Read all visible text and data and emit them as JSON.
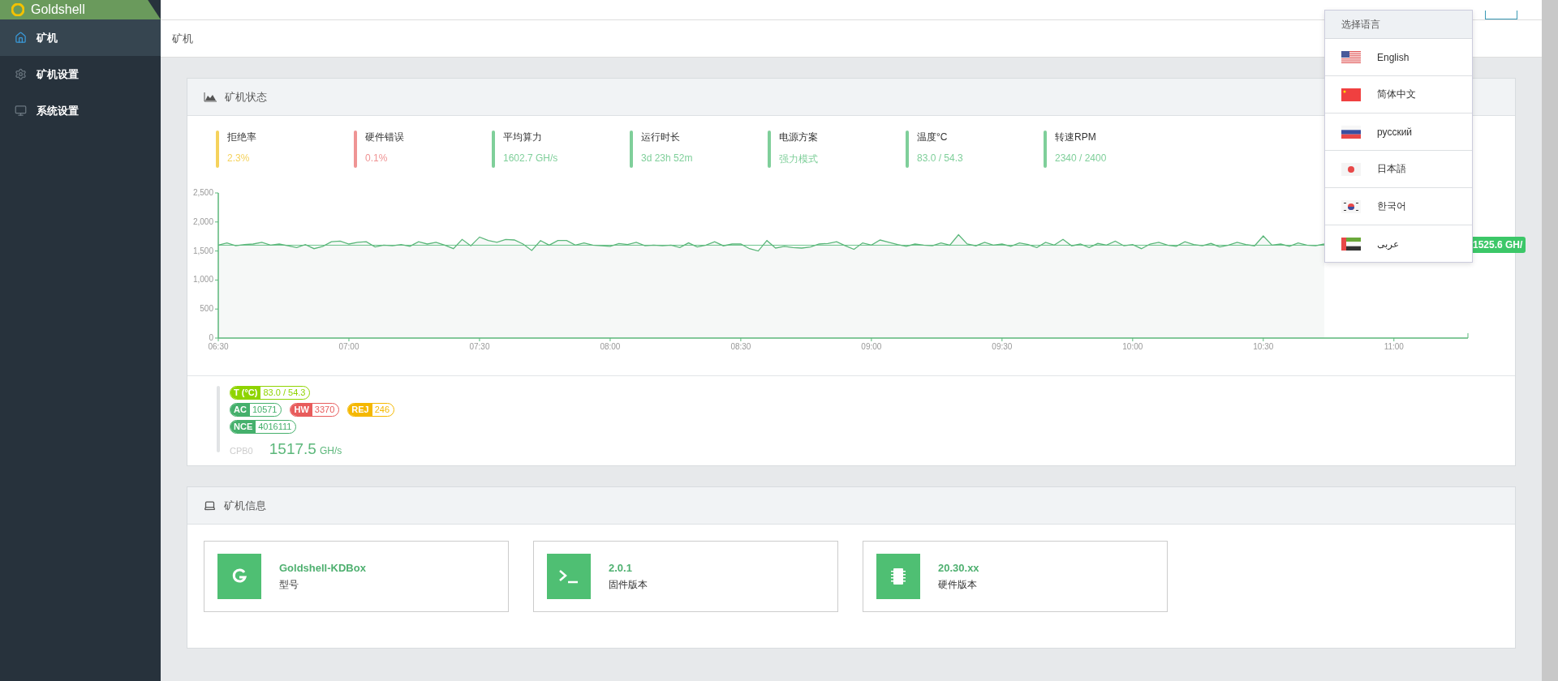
{
  "header": {
    "logo_text": "Goldshell"
  },
  "sidebar": {
    "items": [
      {
        "label": "矿机",
        "selected": true
      },
      {
        "label": "矿机设置",
        "selected": false
      },
      {
        "label": "系统设置",
        "selected": false
      }
    ]
  },
  "breadcrumb": "矿机",
  "status_panel": {
    "title": "矿机状态",
    "stats": [
      {
        "label": "拒绝率",
        "value": "2.3%",
        "color": "#f5d25c"
      },
      {
        "label": "硬件错误",
        "value": "0.1%",
        "color": "#ef9494"
      },
      {
        "label": "平均算力",
        "value": "1602.7 GH/s",
        "color": "#7fcf9a"
      },
      {
        "label": "运行时长",
        "value": "3d 23h 52m",
        "color": "#7fcf9a"
      },
      {
        "label": "电源方案",
        "value": "强力模式",
        "color": "#7fcf9a"
      },
      {
        "label": "温度°C",
        "value": "83.0 / 54.3",
        "color": "#7fcf9a"
      },
      {
        "label": "转速RPM",
        "value": "2340 / 2400",
        "color": "#7fcf9a"
      }
    ],
    "chart_data": {
      "type": "area",
      "categories": [
        "06:30",
        null,
        null,
        null,
        null,
        null,
        null,
        null,
        null,
        null,
        null,
        null,
        null,
        null,
        null,
        "07:00",
        null,
        null,
        null,
        null,
        null,
        null,
        null,
        null,
        null,
        null,
        null,
        null,
        null,
        null,
        "07:30",
        null,
        null,
        null,
        null,
        null,
        null,
        null,
        null,
        null,
        null,
        null,
        null,
        null,
        null,
        "08:00",
        null,
        null,
        null,
        null,
        null,
        null,
        null,
        null,
        null,
        null,
        null,
        null,
        null,
        null,
        "08:30",
        null,
        null,
        null,
        null,
        null,
        null,
        null,
        null,
        null,
        null,
        null,
        null,
        null,
        null,
        "09:00",
        null,
        null,
        null,
        null,
        null,
        null,
        null,
        null,
        null,
        null,
        null,
        null,
        null,
        null,
        "09:30",
        null,
        null,
        null,
        null,
        null,
        null,
        null,
        null,
        null,
        null,
        null,
        null,
        null,
        null,
        "10:00",
        null,
        null,
        null,
        null,
        null,
        null,
        null,
        null,
        null,
        null,
        null,
        null,
        null,
        null,
        "10:30",
        null,
        null,
        null,
        null,
        null,
        null,
        null,
        null,
        null,
        null,
        null,
        null,
        null,
        null,
        "11:00",
        null,
        null,
        null,
        null,
        null,
        null,
        null,
        null
      ],
      "ylim": [
        0,
        2500
      ],
      "yticks": [
        {
          "value": 0,
          "label": "0"
        },
        {
          "value": 500,
          "label": "500"
        },
        {
          "value": 1000,
          "label": "1,000"
        },
        {
          "value": 1500,
          "label": "1,500"
        },
        {
          "value": 2000,
          "label": "2,000"
        },
        {
          "value": 2500,
          "label": "2,500"
        }
      ],
      "series": [
        {
          "color": "#5bb77a",
          "values": [
            1600,
            1640,
            1590,
            1610,
            1620,
            1650,
            1600,
            1620,
            1590,
            1560,
            1610,
            1540,
            1580,
            1660,
            1670,
            1620,
            1650,
            1660,
            1570,
            1600,
            1590,
            1610,
            1580,
            1660,
            1620,
            1650,
            1600,
            1540,
            1700,
            1590,
            1740,
            1680,
            1650,
            1700,
            1690,
            1620,
            1510,
            1680,
            1600,
            1680,
            1680,
            1600,
            1640,
            1600,
            1590,
            1580,
            1630,
            1610,
            1650,
            1590,
            1600,
            1590,
            1600,
            1560,
            1640,
            1570,
            1600,
            1660,
            1590,
            1620,
            1620,
            1540,
            1500,
            1680,
            1550,
            1580,
            1560,
            1550,
            1570,
            1620,
            1630,
            1660,
            1590,
            1530,
            1640,
            1600,
            1690,
            1650,
            1610,
            1580,
            1620,
            1600,
            1590,
            1640,
            1600,
            1780,
            1620,
            1590,
            1650,
            1600,
            1620,
            1580,
            1640,
            1610,
            1560,
            1650,
            1600,
            1700,
            1590,
            1620,
            1560,
            1630,
            1600,
            1670,
            1590,
            1610,
            1540,
            1620,
            1650,
            1600,
            1580,
            1660,
            1610,
            1590,
            1630,
            1570,
            1600,
            1650,
            1610,
            1590,
            1760,
            1600,
            1620,
            1580,
            1640,
            1600,
            1590,
            1620,
            null,
            null,
            null,
            null,
            null,
            null,
            null,
            null,
            null,
            null,
            null,
            null,
            null,
            null,
            null,
            null
          ]
        }
      ],
      "ref_lines": [
        {
          "axis": "y",
          "value": 1600,
          "color": "#6cc48c"
        }
      ],
      "annotations": [
        "1525.6 GH/"
      ]
    },
    "board": {
      "chips": [
        [
          {
            "tag": "T (°C)",
            "value": "83.0 / 54.3",
            "color": "#8fd400"
          }
        ],
        [
          {
            "tag": "AC",
            "value": "10571",
            "color": "#45b06c"
          },
          {
            "tag": "HW",
            "value": "3370",
            "color": "#e85c5c"
          },
          {
            "tag": "REJ",
            "value": "246",
            "color": "#f5b800"
          }
        ],
        [
          {
            "tag": "NCE",
            "value": "4016111",
            "color": "#45b06c"
          }
        ]
      ],
      "name": "CPB0",
      "rate": "1517.5",
      "unit": "GH/s"
    }
  },
  "info_panel": {
    "title": "矿机信息",
    "cards": [
      {
        "kind": "logo",
        "value": "Goldshell-KDBox",
        "label": "型号"
      },
      {
        "kind": "terminal",
        "value": "2.0.1",
        "label": "固件版本"
      },
      {
        "kind": "chip",
        "value": "20.30.xx",
        "label": "硬件版本"
      }
    ]
  },
  "language_menu": {
    "title": "选择语言",
    "items": [
      {
        "kind": "us",
        "label": "English"
      },
      {
        "kind": "cn",
        "label": "简体中文"
      },
      {
        "kind": "ru",
        "label": "русский"
      },
      {
        "kind": "jp",
        "label": "日本語"
      },
      {
        "kind": "kr",
        "label": "한국어"
      },
      {
        "kind": "ae",
        "label": "عربى"
      }
    ]
  }
}
